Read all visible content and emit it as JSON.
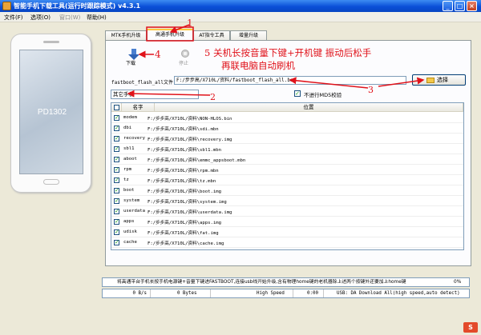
{
  "window": {
    "title": "智能手机下载工具(运行时跟踪模式)  v4.3.1",
    "min_symbol": "_",
    "max_symbol": "□",
    "close_symbol": "×"
  },
  "menu": [
    "文件(F)",
    "选项(O)",
    "窗口(W)",
    "帮助(H)"
  ],
  "phone": {
    "model": "PD1302"
  },
  "tabs": [
    {
      "label": "MTK手机升级",
      "active": false
    },
    {
      "label": "高通手机升级",
      "active": true
    },
    {
      "label": "AT指令工具",
      "active": false
    },
    {
      "label": "增量升级",
      "active": false
    }
  ],
  "toolbar": {
    "download_label": "下载",
    "stop_label": "停止"
  },
  "file": {
    "label": "fastboot_flash_all文件",
    "value": "F:/步步高/X710L/资料/fastboot_flash_all.bat",
    "select_label": "选择"
  },
  "format": {
    "value": "其它手机"
  },
  "md5": {
    "checked": true,
    "label": "不进行MD5校验"
  },
  "table": {
    "headers": [
      "名字",
      "位置"
    ],
    "rows": [
      {
        "name": "modem",
        "path": "F:/步步高/X710L/资料\\NON-HLOS.bin",
        "checked": true
      },
      {
        "name": "dbi",
        "path": "F:/步步高/X710L/资料\\sdi.mbn",
        "checked": true
      },
      {
        "name": "recovery",
        "path": "F:/步步高/X710L/资料\\recovery.img",
        "checked": true
      },
      {
        "name": "sbl1",
        "path": "F:/步步高/X710L/资料\\sbl1.mbn",
        "checked": true
      },
      {
        "name": "aboot",
        "path": "F:/步步高/X710L/资料\\emmc_appsboot.mbn",
        "checked": true
      },
      {
        "name": "rpm",
        "path": "F:/步步高/X710L/资料\\rpm.mbn",
        "checked": true
      },
      {
        "name": "tz",
        "path": "F:/步步高/X710L/资料\\tz.mbn",
        "checked": true
      },
      {
        "name": "boot",
        "path": "F:/步步高/X710L/资料\\boot.img",
        "checked": true
      },
      {
        "name": "system",
        "path": "F:/步步高/X710L/资料\\system.img",
        "checked": true
      },
      {
        "name": "userdata",
        "path": "F:/步步高/X710L/资料\\userdata.img",
        "checked": true
      },
      {
        "name": "apps",
        "path": "F:/步步高/X710L/资料\\apps.img",
        "checked": true
      },
      {
        "name": "udisk",
        "path": "F:/步步高/X710L/资料\\fat.img",
        "checked": true
      },
      {
        "name": "cache",
        "path": "F:/步步高/X710L/资料\\cache.img",
        "checked": true
      }
    ]
  },
  "annotations": {
    "n1": "1",
    "n2": "2",
    "n3": "3",
    "n4": "4",
    "line1": "5  关机长按音量下键+开机键  振动后松手",
    "line2": "再联电脑自动刷机"
  },
  "status": {
    "message": "将高通平台手机长按手机电源键+音量下键进FASTBOOT,连接usb线开始升级,含有物理home键的老机器除上述两个按键外还要加上home键",
    "percent": "0%",
    "speed": "0 B/s",
    "bytes": "0 Bytes",
    "mode": "High Speed",
    "time": "0:00",
    "usb": "USB: DA Download All(high speed,auto detect)"
  },
  "colors": {
    "annotation": "#e0121a",
    "titlebar": "#0a4fd8",
    "check": "#21a121"
  },
  "corner_logo": "S"
}
